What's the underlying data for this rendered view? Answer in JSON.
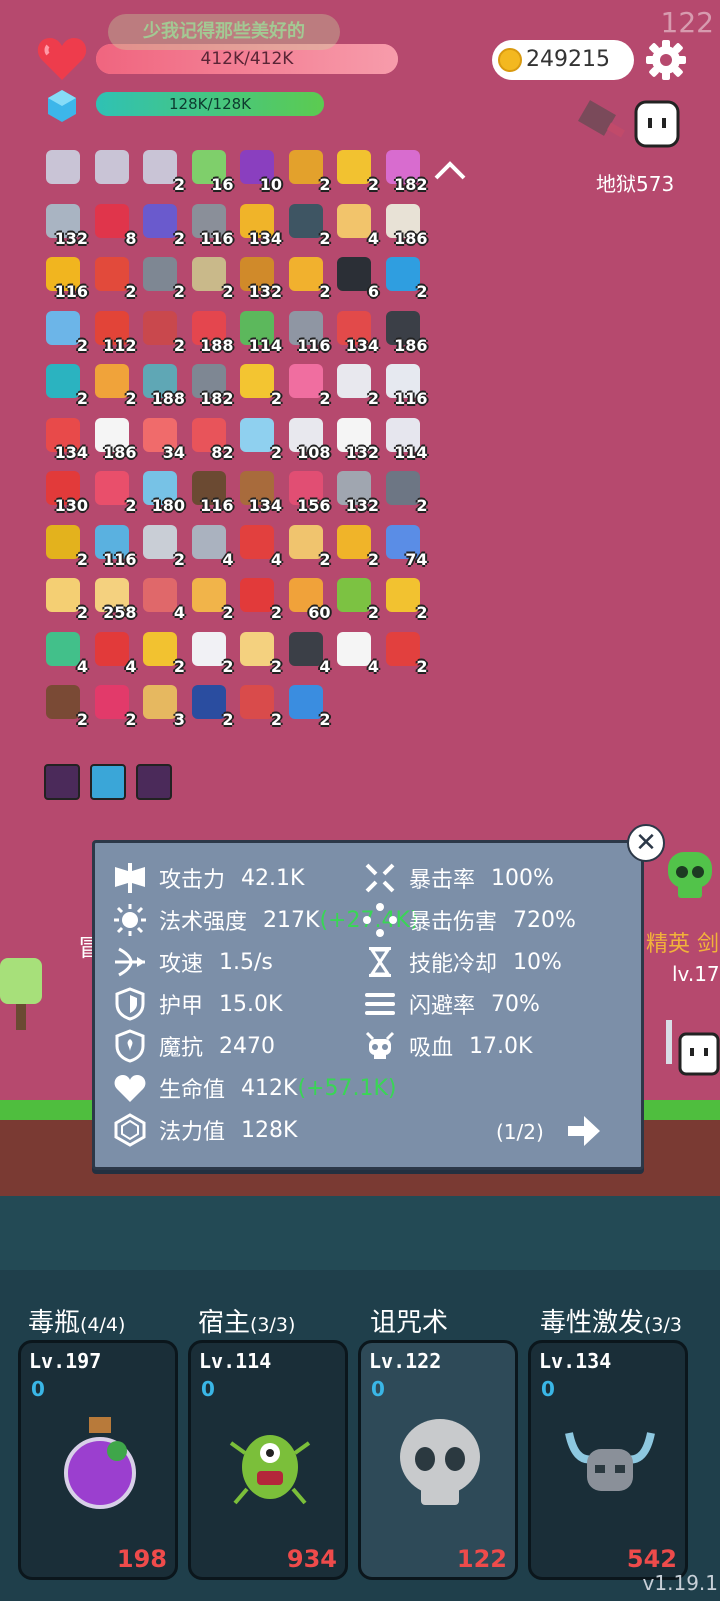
{
  "top": {
    "fps": "122",
    "ticker": "少我记得那些美好的",
    "hp_text": "412K/412K",
    "hp_fraction": 1.0,
    "mp_text": "128K/128K",
    "mp_fraction": 1.0,
    "coins": "249215",
    "floor": "地狱573"
  },
  "items": [
    {
      "icon": "flag-icon",
      "count": "",
      "color": "#c9c4d6"
    },
    {
      "icon": "flag-icon",
      "count": "",
      "color": "#c9c4d6"
    },
    {
      "icon": "flag-icon",
      "count": "2",
      "color": "#c9c4d6"
    },
    {
      "icon": "book-icon",
      "count": "16",
      "color": "#7fcf6b"
    },
    {
      "icon": "potion-icon",
      "count": "10",
      "color": "#8a3fbf"
    },
    {
      "icon": "pineapple-icon",
      "count": "2",
      "color": "#e3a12c"
    },
    {
      "icon": "sun-icon",
      "count": "2",
      "color": "#f2c230"
    },
    {
      "icon": "flower-icon",
      "count": "182",
      "color": "#d86ccf"
    },
    {
      "icon": "sword-icon",
      "count": "132",
      "color": "#a9b4c2"
    },
    {
      "icon": "ruby-icon",
      "count": "8",
      "color": "#e0354b"
    },
    {
      "icon": "wizard-hat-icon",
      "count": "2",
      "color": "#6a5acd"
    },
    {
      "icon": "gate-icon",
      "count": "116",
      "color": "#8a8f99"
    },
    {
      "icon": "coins-icon",
      "count": "134",
      "color": "#f0b429"
    },
    {
      "icon": "mortar-icon",
      "count": "2",
      "color": "#3e5563"
    },
    {
      "icon": "scroll-icon",
      "count": "4",
      "color": "#f2c46b"
    },
    {
      "icon": "flag-goal-icon",
      "count": "186",
      "color": "#e8e2d6"
    },
    {
      "icon": "sunflower-icon",
      "count": "116",
      "color": "#f1b51f"
    },
    {
      "icon": "mushroom-icon",
      "count": "2",
      "color": "#e24a3b"
    },
    {
      "icon": "spike-ball-icon",
      "count": "2",
      "color": "#7e8793"
    },
    {
      "icon": "dots-icon",
      "count": "2",
      "color": "#c9b98a"
    },
    {
      "icon": "tome-icon",
      "count": "132",
      "color": "#d08a2a"
    },
    {
      "icon": "beer-icon",
      "count": "2",
      "color": "#f1b12e"
    },
    {
      "icon": "cauldron-icon",
      "count": "6",
      "color": "#2b2f36"
    },
    {
      "icon": "card-star-icon",
      "count": "2",
      "color": "#2f9ee0"
    },
    {
      "icon": "coat-icon",
      "count": "2",
      "color": "#6cb5e8"
    },
    {
      "icon": "tomato-icon",
      "count": "112",
      "color": "#e24438"
    },
    {
      "icon": "shield-icon",
      "count": "2",
      "color": "#c9484d"
    },
    {
      "icon": "heart-icon",
      "count": "188",
      "color": "#e4464e"
    },
    {
      "icon": "cash-heart-icon",
      "count": "114",
      "color": "#5cb85c"
    },
    {
      "icon": "axe-icon",
      "count": "116",
      "color": "#8f96a3"
    },
    {
      "icon": "sock-icon",
      "count": "134",
      "color": "#e24a4a"
    },
    {
      "icon": "robot-icon",
      "count": "186",
      "color": "#3b3f47"
    },
    {
      "icon": "target-icon",
      "count": "2",
      "color": "#2bb3c0"
    },
    {
      "icon": "briefcase-icon",
      "count": "2",
      "color": "#f0a33a"
    },
    {
      "icon": "tire-icon",
      "count": "188",
      "color": "#5fa7b5"
    },
    {
      "icon": "spiked-mace-icon",
      "count": "182",
      "color": "#7e8793"
    },
    {
      "icon": "crown-icon",
      "count": "2",
      "color": "#f3c531"
    },
    {
      "icon": "ice-cream-icon",
      "count": "2",
      "color": "#f06ea0"
    },
    {
      "icon": "cards-icon",
      "count": "2",
      "color": "#e8e8ee"
    },
    {
      "icon": "envelope-icon",
      "count": "116",
      "color": "#e6e9f0"
    },
    {
      "icon": "watermelon-icon",
      "count": "134",
      "color": "#e84a4a"
    },
    {
      "icon": "ghost-icon",
      "count": "186",
      "color": "#f5f5f5"
    },
    {
      "icon": "rainbow-icon",
      "count": "34",
      "color": "#f06b6b"
    },
    {
      "icon": "pill-icon",
      "count": "82",
      "color": "#e8545a"
    },
    {
      "icon": "frame-icon",
      "count": "2",
      "color": "#8fd0ef"
    },
    {
      "icon": "dice-icon",
      "count": "108",
      "color": "#e8e8ee"
    },
    {
      "icon": "egg-icon",
      "count": "132",
      "color": "#f5f5f5"
    },
    {
      "icon": "spray-icon",
      "count": "114",
      "color": "#e6e6ee"
    },
    {
      "icon": "apple-icon",
      "count": "130",
      "color": "#e23a3a"
    },
    {
      "icon": "chain-icon",
      "count": "2",
      "color": "#e94f6b"
    },
    {
      "icon": "cookie-jar-icon",
      "count": "180",
      "color": "#77c2e6"
    },
    {
      "icon": "coconut-icon",
      "count": "116",
      "color": "#6b4a32"
    },
    {
      "icon": "donut-icon",
      "count": "134",
      "color": "#a86b3c"
    },
    {
      "icon": "jam-jar-icon",
      "count": "156",
      "color": "#e14e73"
    },
    {
      "icon": "meteor-icon",
      "count": "132",
      "color": "#a0a6b0"
    },
    {
      "icon": "compass-icon",
      "count": "2",
      "color": "#6d7684"
    },
    {
      "icon": "durian-icon",
      "count": "2",
      "color": "#e3b21d"
    },
    {
      "icon": "syringe-icon",
      "count": "116",
      "color": "#5ab1e0"
    },
    {
      "icon": "hook-icon",
      "count": "2",
      "color": "#c9ced6"
    },
    {
      "icon": "crossed-swords-icon",
      "count": "4",
      "color": "#aab2bf"
    },
    {
      "icon": "map-pin-icon",
      "count": "4",
      "color": "#e2403e"
    },
    {
      "icon": "parchment-icon",
      "count": "2",
      "color": "#f0c46e"
    },
    {
      "icon": "ring-icon",
      "count": "2",
      "color": "#f0b429"
    },
    {
      "icon": "capsule-icon",
      "count": "74",
      "color": "#5a8de6"
    },
    {
      "icon": "note-pencil-icon",
      "count": "2",
      "color": "#f4cf73"
    },
    {
      "icon": "map-icon",
      "count": "258",
      "color": "#f4d17f"
    },
    {
      "icon": "steak-icon",
      "count": "4",
      "color": "#e0686a"
    },
    {
      "icon": "recipe-book-icon",
      "count": "2",
      "color": "#f1b44a"
    },
    {
      "icon": "magnet-icon",
      "count": "2",
      "color": "#e23a3a"
    },
    {
      "icon": "bread-icon",
      "count": "60",
      "color": "#f0a23a"
    },
    {
      "icon": "lime-icon",
      "count": "2",
      "color": "#7cc242"
    },
    {
      "icon": "magic-wand-icon",
      "count": "2",
      "color": "#f2c230"
    },
    {
      "icon": "figure-icon",
      "count": "4",
      "color": "#42c08a"
    },
    {
      "icon": "bookmark-icon",
      "count": "4",
      "color": "#e23a3a"
    },
    {
      "icon": "crown-outline-icon",
      "count": "2",
      "color": "#f2c230"
    },
    {
      "icon": "checklist-icon",
      "count": "2",
      "color": "#f1f1f5"
    },
    {
      "icon": "treasure-map-icon",
      "count": "2",
      "color": "#f4d17f"
    },
    {
      "icon": "bat-icon",
      "count": "4",
      "color": "#3b3f47"
    },
    {
      "icon": "speech-bubble-icon",
      "count": "4",
      "color": "#f5f5f5"
    },
    {
      "icon": "flames-icon",
      "count": "2",
      "color": "#e2403e"
    },
    {
      "icon": "brown-mushroom-icon",
      "count": "2",
      "color": "#7a4a35"
    },
    {
      "icon": "fire-drop-icon",
      "count": "2",
      "color": "#e23a6a"
    },
    {
      "icon": "old-map-icon",
      "count": "3",
      "color": "#e6b860"
    },
    {
      "icon": "bible-icon",
      "count": "2",
      "color": "#2a4da0"
    },
    {
      "icon": "mushroom-cluster-icon",
      "count": "2",
      "color": "#d94b4b"
    },
    {
      "icon": "snowflake-arrows-icon",
      "count": "2",
      "color": "#3a8de0"
    }
  ],
  "runes": [
    {
      "icon": "demon-rune-icon",
      "color": "#4b2a5a"
    },
    {
      "icon": "light-rune-icon",
      "color": "#3aa6d8"
    },
    {
      "icon": "demon-rune-icon",
      "color": "#4b2a5a"
    }
  ],
  "scene": {
    "left_label": "冒",
    "elite": "精英 剑",
    "level": "lv.17"
  },
  "stats": {
    "attack": {
      "label": "攻击力",
      "value": "42.1K"
    },
    "crit_rate": {
      "label": "暴击率",
      "value": "100%"
    },
    "spell_power": {
      "label": "法术强度",
      "value": "217K",
      "bonus": "(+27.4K)"
    },
    "crit_damage": {
      "label": "暴击伤害",
      "value": "720%"
    },
    "attack_speed": {
      "label": "攻速",
      "value": "1.5/s"
    },
    "cooldown": {
      "label": "技能冷却",
      "value": "10%"
    },
    "armor": {
      "label": "护甲",
      "value": "15.0K"
    },
    "dodge": {
      "label": "闪避率",
      "value": "70%"
    },
    "magic_resist": {
      "label": "魔抗",
      "value": "2470"
    },
    "lifesteal": {
      "label": "吸血",
      "value": "17.0K"
    },
    "health": {
      "label": "生命值",
      "value": "412K",
      "bonus": "(+57.1K)"
    },
    "mana": {
      "label": "法力值",
      "value": "128K"
    },
    "page": "(1/2)"
  },
  "skills": [
    {
      "name": "毒瓶",
      "slots": "(4/4)",
      "level": "Lv.197",
      "zero": "0",
      "num": "198",
      "icon": "poison-bottle-icon"
    },
    {
      "name": "宿主",
      "slots": "(3/3)",
      "level": "Lv.114",
      "zero": "0",
      "num": "934",
      "icon": "germ-monster-icon"
    },
    {
      "name": "诅咒术",
      "slots": "",
      "level": "Lv.122",
      "zero": "0",
      "num": "122",
      "icon": "skull-icon"
    },
    {
      "name": "毒性激发",
      "slots": "(3/3",
      "level": "Lv.134",
      "zero": "0",
      "num": "542",
      "icon": "horned-helmet-icon"
    }
  ],
  "version": "v1.19.1"
}
